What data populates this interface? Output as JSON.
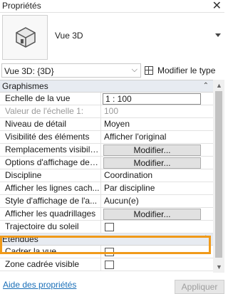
{
  "window": {
    "title": "Propriétés"
  },
  "type_selector": {
    "name": "Vue 3D"
  },
  "instance_selector": {
    "value": "Vue 3D: {3D}",
    "edit_type_label": "Modifier le type"
  },
  "groups": [
    {
      "label": "Graphismes",
      "rows": [
        {
          "name": "Echelle de la vue",
          "value": "1 : 100",
          "kind": "boxed"
        },
        {
          "name": "Valeur de l'échelle    1:",
          "value": "100",
          "kind": "disabled"
        },
        {
          "name": "Niveau de détail",
          "value": "Moyen",
          "kind": "text"
        },
        {
          "name": "Visibilité des éléments",
          "value": "Afficher l'original",
          "kind": "text"
        },
        {
          "name": "Remplacements visibilit...",
          "value": "Modifier...",
          "kind": "button"
        },
        {
          "name": "Options d'affichage des...",
          "value": "Modifier...",
          "kind": "button"
        },
        {
          "name": "Discipline",
          "value": "Coordination",
          "kind": "text"
        },
        {
          "name": "Afficher les lignes cach...",
          "value": "Par discipline",
          "kind": "text"
        },
        {
          "name": "Style d'affichage de l'a...",
          "value": "Aucun(e)",
          "kind": "text"
        },
        {
          "name": "Afficher les quadrillages",
          "value": "Modifier...",
          "kind": "button"
        },
        {
          "name": "Trajectoire du soleil",
          "value": "",
          "kind": "checkbox"
        }
      ]
    },
    {
      "label": "Etendues",
      "rows": [
        {
          "name": "Cadrer la vue",
          "value": "",
          "kind": "checkbox"
        },
        {
          "name": "Zone cadrée visible",
          "value": "",
          "kind": "checkbox"
        }
      ]
    }
  ],
  "footer": {
    "help_link": "Aide des propriétés",
    "apply_label": "Appliquer"
  },
  "icons": {
    "close": "close-icon",
    "house": "3d-view-house-icon",
    "edit_type": "edit-type-icon"
  },
  "colors": {
    "highlight": "#f09a1a",
    "group_header": "#e7ebf1",
    "link": "#1a6fb8"
  }
}
